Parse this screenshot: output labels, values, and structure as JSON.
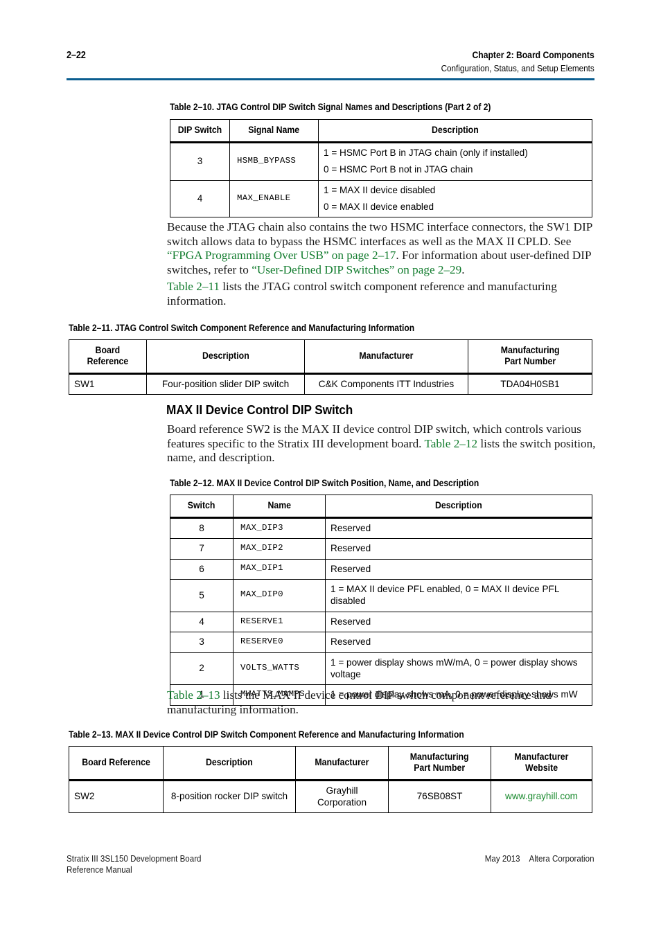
{
  "header": {
    "folio": "2–22",
    "chapter": "Chapter 2:  Board Components",
    "section": "Configuration, Status, and Setup Elements",
    "rule_color": "#0b5d8f"
  },
  "link_color": "#127c2e",
  "table_2_10": {
    "caption": "Table 2–10.  JTAG Control DIP Switch Signal Names and Descriptions  (Part 2 of 2)",
    "columns": [
      "DIP Switch",
      "Signal Name",
      "Description"
    ],
    "rows": [
      {
        "switch": "3",
        "signal": "HSMB_BYPASS",
        "desc_lines": [
          "1 = HSMC Port B in JTAG chain (only if installed)",
          "0 = HSMC Port B not in JTAG chain"
        ]
      },
      {
        "switch": "4",
        "signal": "MAX_ENABLE",
        "desc_lines": [
          "1 = MAX II device disabled",
          "0 = MAX II device enabled"
        ]
      }
    ]
  },
  "para_1": {
    "t1": "Because the JTAG chain also contains the two HSMC interface connectors, the SW1 DIP switch allows data to bypass the HSMC interfaces as well as the MAX II CPLD. See ",
    "link1": "“FPGA Programming Over USB” on page 2–17",
    "t2": ". For information about user-defined DIP switches, refer to ",
    "link2": "“User-Defined DIP Switches” on page 2–29",
    "t3": "."
  },
  "para_2": {
    "link1": "Table 2–11",
    "t1": " lists the JTAG control switch component reference and manufacturing information."
  },
  "table_2_11": {
    "caption": "Table 2–11.  JTAG Control Switch Component Reference and Manufacturing Information",
    "columns": [
      "Board\nReference",
      "Description",
      "Manufacturer",
      "Manufacturing\nPart Number"
    ],
    "columns_l1": [
      "Board",
      "Description",
      "Manufacturer",
      "Manufacturing"
    ],
    "columns_l2": [
      "Reference",
      "",
      "",
      "Part Number"
    ],
    "rows": [
      {
        "board_reference": "SW1",
        "description": "Four-position slider DIP switch",
        "manufacturer": "C&K Components ITT Industries",
        "part_number": "TDA04H0SB1"
      }
    ]
  },
  "section_heading": "MAX II Device Control DIP Switch",
  "para_3": {
    "t1": "Board reference SW2 is the MAX II device control DIP switch, which controls various features specific to the Stratix III development board. ",
    "link1": "Table 2–12",
    "t2": " lists the switch position, name, and description."
  },
  "table_2_12": {
    "caption": "Table 2–12.  MAX II Device Control DIP Switch Position, Name, and Description",
    "columns": [
      "Switch",
      "Name",
      "Description"
    ],
    "rows": [
      {
        "switch": "8",
        "name": "MAX_DIP3",
        "description": "Reserved"
      },
      {
        "switch": "7",
        "name": "MAX_DIP2",
        "description": "Reserved"
      },
      {
        "switch": "6",
        "name": "MAX_DIP1",
        "description": "Reserved"
      },
      {
        "switch": "5",
        "name": "MAX_DIP0",
        "description": "1 = MAX II device PFL enabled, 0 = MAX II device PFL disabled"
      },
      {
        "switch": "4",
        "name": "RESERVE1",
        "description": "Reserved"
      },
      {
        "switch": "3",
        "name": "RESERVE0",
        "description": "Reserved"
      },
      {
        "switch": "2",
        "name": "VOLTS_WATTS",
        "description": "1 = power display shows mW/mA, 0 = power display shows voltage"
      },
      {
        "switch": "1",
        "name": "MWATTS_MAMPS",
        "description": "1 = power display shows mA, 0 = power display shows mW"
      }
    ]
  },
  "para_4": {
    "link1": "Table 2–13",
    "t1": " lists the MAX II device control DIP switch component reference and manufacturing information."
  },
  "table_2_13": {
    "caption": "Table 2–13.  MAX II Device Control DIP Switch Component Reference and Manufacturing Information",
    "columns_l1": [
      "Board Reference",
      "Description",
      "Manufacturer",
      "Manufacturing",
      "Manufacturer"
    ],
    "columns_l2": [
      "",
      "",
      "",
      "Part Number",
      "Website"
    ],
    "rows": [
      {
        "board_reference": "SW2",
        "description": "8-position rocker DIP switch",
        "manufacturer": "Grayhill Corporation",
        "part_number": "76SB08ST",
        "website": "www.grayhill.com"
      }
    ]
  },
  "footer": {
    "left_line1": "Stratix III 3SL150 Development Board",
    "left_line2": "Reference Manual",
    "date": "May 2013",
    "company": "Altera Corporation"
  }
}
